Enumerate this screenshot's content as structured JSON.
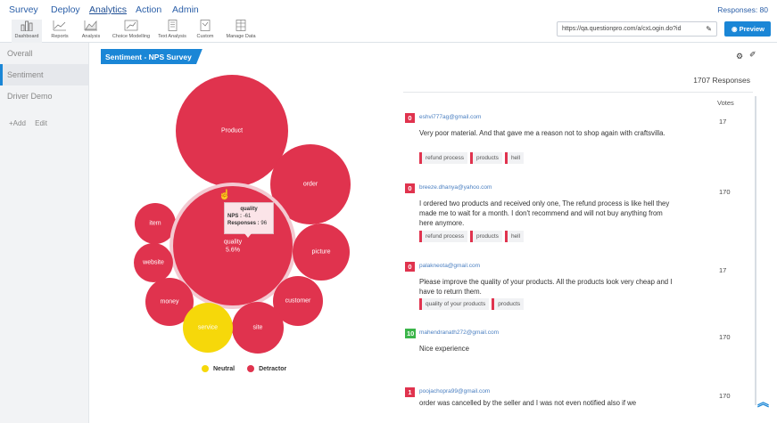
{
  "topnav": {
    "items": [
      "Survey",
      "Deploy",
      "Analytics",
      "Action",
      "Admin"
    ],
    "active": "Analytics",
    "responses": "Responses: 80"
  },
  "toolbar": {
    "tools": [
      {
        "label": "Dashboard",
        "icon": "bar-chart-icon"
      },
      {
        "label": "Reports",
        "icon": "line-chart-icon"
      },
      {
        "label": "Analysis",
        "icon": "area-chart-icon"
      },
      {
        "label": "Choice Modelling",
        "icon": "trend-chart-icon"
      },
      {
        "label": "Text Analysis",
        "icon": "document-icon"
      },
      {
        "label": "Custom",
        "icon": "custom-report-icon"
      },
      {
        "label": "Manage Data",
        "icon": "spreadsheet-icon"
      }
    ],
    "url": "https://qa.questionpro.com/a/cxLogin.do?id",
    "preview_label": "Preview"
  },
  "sidebar": {
    "items": [
      "Overall",
      "Sentiment",
      "Driver Demo"
    ],
    "active": "Sentiment",
    "add_label": "+Add",
    "edit_label": "Edit"
  },
  "section_title": "Sentiment - NPS Survey",
  "chart_data": {
    "type": "bubble",
    "colors": {
      "Detractor": "#e0334e",
      "Neutral": "#f6d80a"
    },
    "bubbles": [
      {
        "label": "Product",
        "category": "Detractor"
      },
      {
        "label": "order",
        "category": "Detractor"
      },
      {
        "label": "item",
        "category": "Detractor"
      },
      {
        "label": "quality",
        "sub": "5.6%",
        "category": "Detractor"
      },
      {
        "label": "picture",
        "category": "Detractor"
      },
      {
        "label": "website",
        "category": "Detractor"
      },
      {
        "label": "customer",
        "category": "Detractor"
      },
      {
        "label": "money",
        "category": "Detractor"
      },
      {
        "label": "site",
        "category": "Detractor"
      },
      {
        "label": "service",
        "category": "Neutral"
      }
    ],
    "tooltip": {
      "title": "quality",
      "nps_label": "NPS :",
      "nps": "-61",
      "responses_label": "Responses :",
      "responses": "96"
    },
    "legend": [
      "Neutral",
      "Detractor"
    ]
  },
  "responses": {
    "total": "1707 Responses",
    "votes_header": "Votes",
    "items": [
      {
        "nps": "0",
        "nps_color": "#e0334e",
        "email": "eshvi777ag@gmail.com",
        "text": "Very poor material. And that gave me a reason not to shop again with craftsvilla.",
        "votes": "17",
        "tags": [
          "refund process",
          "products",
          "hell"
        ]
      },
      {
        "nps": "0",
        "nps_color": "#e0334e",
        "email": "breeze.dhanya@yahoo.com",
        "text": "I ordered two products and received only one, The refund process is like hell they made me to wait for a month. I don't recommend and will not buy anything from here anymore.",
        "votes": "170",
        "tags": [
          "refund process",
          "products",
          "hell"
        ]
      },
      {
        "nps": "0",
        "nps_color": "#e0334e",
        "email": "palakneota@gmail.com",
        "text": "Please improve the quality of your products. All the products look very cheap and I have to return them.",
        "votes": "17",
        "tags": [
          "quality of your products",
          "products"
        ]
      },
      {
        "nps": "10",
        "nps_color": "#3bb54a",
        "email": "mahendranath272@gmail.com",
        "text": "Nice experience",
        "votes": "170",
        "tags": []
      },
      {
        "nps": "1",
        "nps_color": "#e0334e",
        "email": "poojachopra99@gmail.com",
        "text": "order was cancelled by the seller and I was not even notified also if we",
        "votes": "170",
        "tags": []
      }
    ]
  }
}
